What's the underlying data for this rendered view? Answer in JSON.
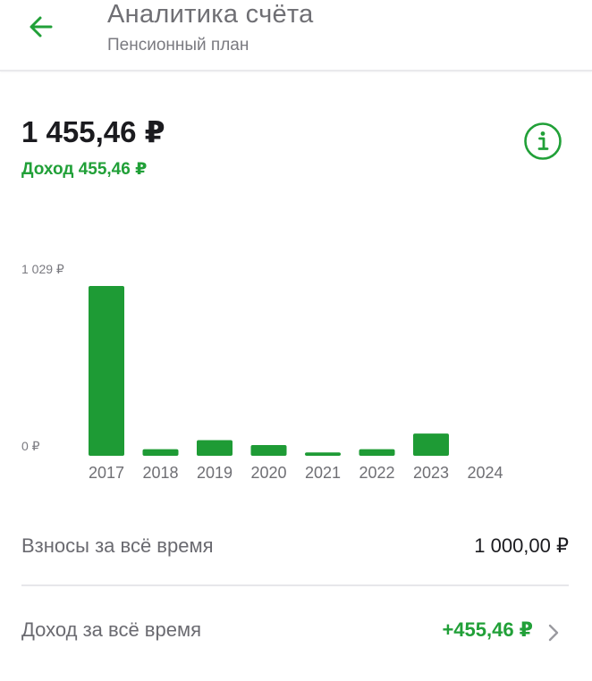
{
  "header": {
    "title": "Аналитика счёта",
    "subtitle": "Пенсионный план"
  },
  "summary": {
    "balance": "1 455,46 ₽",
    "income": "Доход 455,46 ₽"
  },
  "colors": {
    "accent": "#21a038",
    "bar": "#1e9b35"
  },
  "icons": {
    "back": "arrow-left-icon",
    "info": "info-icon",
    "chevron": "chevron-right-icon"
  },
  "chart_data": {
    "type": "bar",
    "categories": [
      "2017",
      "2018",
      "2019",
      "2020",
      "2021",
      "2022",
      "2023",
      "2024"
    ],
    "values": [
      1029,
      40,
      95,
      65,
      20,
      40,
      135,
      0
    ],
    "y_tick_labels": [
      "1 029 ₽",
      "0 ₽"
    ],
    "ylim": [
      0,
      1029
    ],
    "grid": false,
    "legend": "none"
  },
  "stats": {
    "contributions_label": "Взносы за всё время",
    "contributions_value": "1 000,00 ₽",
    "income_label": "Доход за всё время",
    "income_value": "+455,46 ₽"
  }
}
